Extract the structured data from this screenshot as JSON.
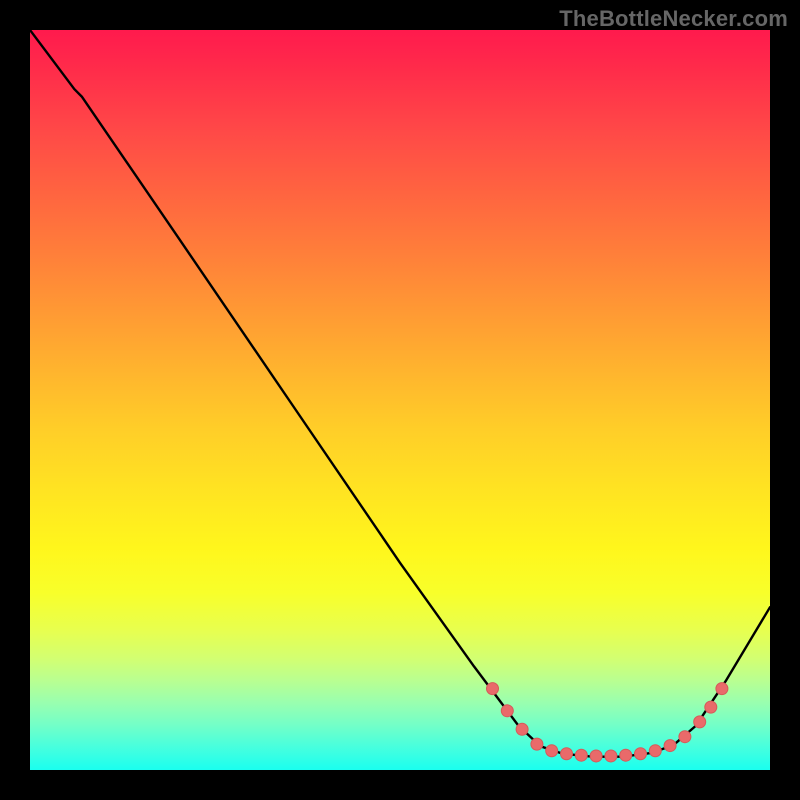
{
  "watermark": "TheBottleNecker.com",
  "chart_data": {
    "type": "line",
    "title": "",
    "xlabel": "",
    "ylabel": "",
    "xlim": [
      0,
      100
    ],
    "ylim": [
      0,
      100
    ],
    "curve": [
      {
        "x": 0,
        "y": 100
      },
      {
        "x": 6,
        "y": 92
      },
      {
        "x": 7,
        "y": 91
      },
      {
        "x": 20,
        "y": 72
      },
      {
        "x": 35,
        "y": 50
      },
      {
        "x": 50,
        "y": 28
      },
      {
        "x": 60,
        "y": 14
      },
      {
        "x": 63,
        "y": 10
      },
      {
        "x": 66,
        "y": 6
      },
      {
        "x": 69,
        "y": 3.2
      },
      {
        "x": 72,
        "y": 2.2
      },
      {
        "x": 76,
        "y": 1.8
      },
      {
        "x": 80,
        "y": 1.8
      },
      {
        "x": 84,
        "y": 2.3
      },
      {
        "x": 87,
        "y": 3.4
      },
      {
        "x": 90,
        "y": 6
      },
      {
        "x": 94,
        "y": 12
      },
      {
        "x": 100,
        "y": 22
      }
    ],
    "markers": [
      {
        "x": 62.5,
        "y": 11
      },
      {
        "x": 64.5,
        "y": 8
      },
      {
        "x": 66.5,
        "y": 5.5
      },
      {
        "x": 68.5,
        "y": 3.5
      },
      {
        "x": 70.5,
        "y": 2.6
      },
      {
        "x": 72.5,
        "y": 2.2
      },
      {
        "x": 74.5,
        "y": 2.0
      },
      {
        "x": 76.5,
        "y": 1.9
      },
      {
        "x": 78.5,
        "y": 1.9
      },
      {
        "x": 80.5,
        "y": 2.0
      },
      {
        "x": 82.5,
        "y": 2.2
      },
      {
        "x": 84.5,
        "y": 2.6
      },
      {
        "x": 86.5,
        "y": 3.3
      },
      {
        "x": 88.5,
        "y": 4.5
      },
      {
        "x": 90.5,
        "y": 6.5
      },
      {
        "x": 92.0,
        "y": 8.5
      },
      {
        "x": 93.5,
        "y": 11
      }
    ],
    "colors": {
      "curve": "#000000",
      "marker_fill": "#e96a6a",
      "marker_stroke": "#d65a5a"
    }
  }
}
